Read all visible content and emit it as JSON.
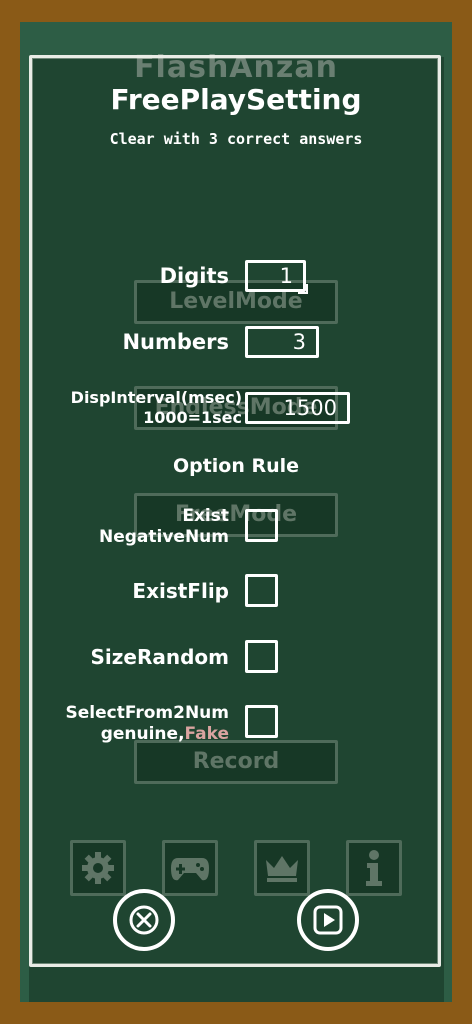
{
  "background_menu": {
    "app_title": "FlashAnzan",
    "level_mode": "LevelMode",
    "endless_mode": "EndlessMode",
    "free_mode": "FreeMode",
    "record": "Record"
  },
  "dialog": {
    "title": "FreePlaySetting",
    "subtitle": "Clear with 3 correct answers",
    "digits": {
      "label": "Digits",
      "value": "1"
    },
    "numbers": {
      "label": "Numbers",
      "value": "3"
    },
    "disp_interval": {
      "label_line1": "DispInterval(msec)",
      "label_line2": "1000=1sec",
      "value": "1500"
    },
    "option_rule": "Option Rule",
    "negative": {
      "label_line1": "Exist",
      "label_line2": "NegativeNum",
      "checked": false
    },
    "flip": {
      "label": "ExistFlip",
      "checked": false
    },
    "size_random": {
      "label": "SizeRandom",
      "checked": false
    },
    "select_from_2": {
      "label_line1": "SelectFrom2Num",
      "label_line2a": "genuine,",
      "label_line2b": "Fake",
      "checked": false
    }
  },
  "icons": {
    "settings": "gear-icon",
    "game": "gamepad-icon",
    "ranking": "crown-icon",
    "info": "info-icon",
    "close": "close-icon",
    "play": "play-icon"
  },
  "colors": {
    "frame": "#8a5a17",
    "board": "#1f4531",
    "chalk": "#ffffff",
    "fake_text": "#d9a4a0"
  }
}
